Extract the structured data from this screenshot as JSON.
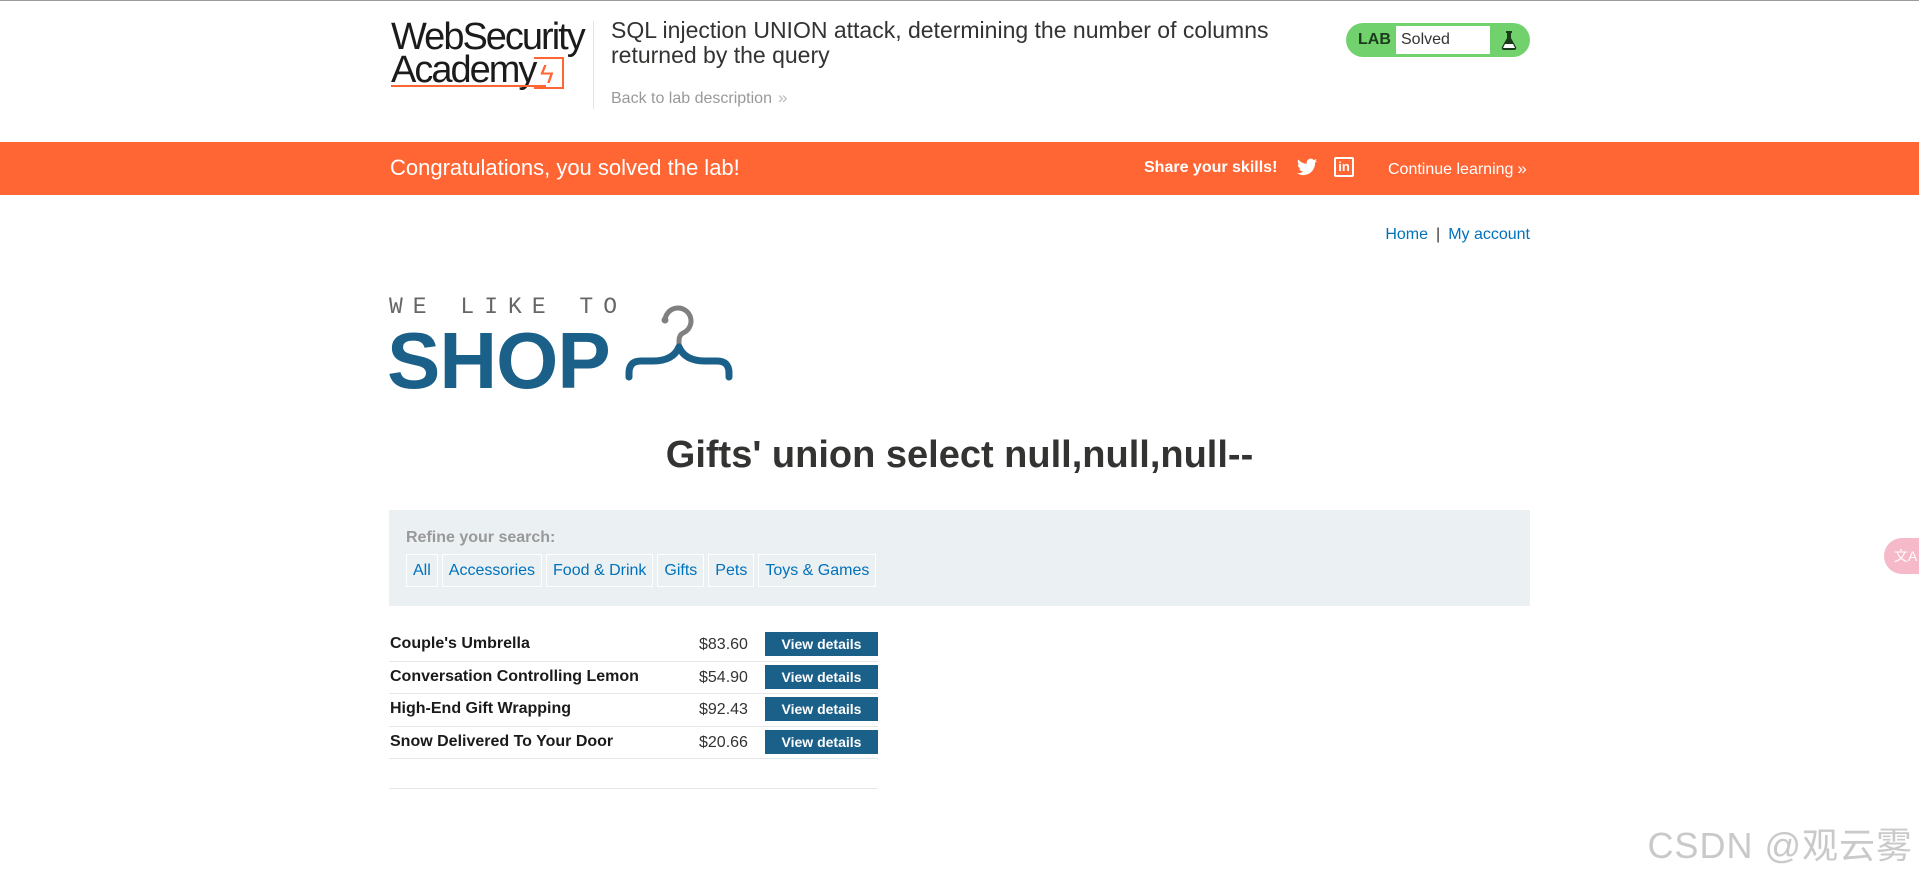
{
  "lab_header": {
    "logo_line1": "WebSecurity",
    "logo_line2": "Academy",
    "title": "SQL injection UNION attack, determining the number of columns returned by the query",
    "back_link": "Back to lab description",
    "back_chevron": "»",
    "status_label": "LAB",
    "status_value": "Solved",
    "status_icon": "flask-icon"
  },
  "banner": {
    "message": "Congratulations, you solved the lab!",
    "share_label": "Share your skills!",
    "twitter_icon": "twitter-icon",
    "linkedin_icon": "linkedin-icon",
    "linkedin_glyph": "in",
    "continue_label": "Continue learning",
    "continue_chevron": "»",
    "color": "#ff6633"
  },
  "nav": {
    "home": "Home",
    "separator": "|",
    "my_account": "My account"
  },
  "shop_logo": {
    "tagline": "WE LIKE TO",
    "word": "SHOP",
    "icon": "hanger-icon",
    "color": "#1b6088"
  },
  "results": {
    "title": "Gifts' union select null,null,null--"
  },
  "filters": {
    "label": "Refine your search:",
    "categories": [
      "All",
      "Accessories",
      "Food & Drink",
      "Gifts",
      "Pets",
      "Toys & Games"
    ]
  },
  "products": [
    {
      "name": "Couple's Umbrella",
      "price": "$83.60",
      "action": "View details"
    },
    {
      "name": "Conversation Controlling Lemon",
      "price": "$54.90",
      "action": "View details"
    },
    {
      "name": "High-End Gift Wrapping",
      "price": "$92.43",
      "action": "View details"
    },
    {
      "name": "Snow Delivered To Your Door",
      "price": "$20.66",
      "action": "View details"
    }
  ],
  "side_widget": {
    "icon": "translate-icon",
    "glyph": "文A"
  },
  "watermark": "CSDN @观云雾"
}
